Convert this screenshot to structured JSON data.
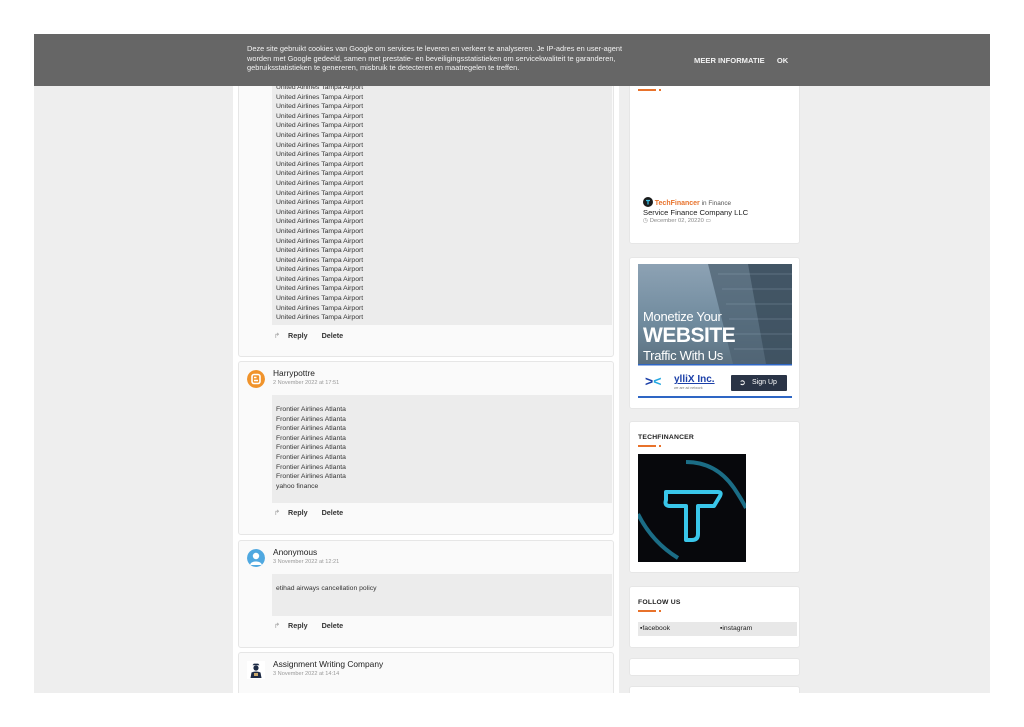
{
  "cookie_bar": {
    "line1": "Deze site gebruikt cookies van Google om services te leveren en verkeer te analyseren. Je IP-adres en user-agent",
    "line2": "worden met Google gedeeld, samen met prestatie- en beveiligingsstatistieken om servicekwaliteit te garanderen,",
    "line3": "gebruiksstatistieken te genereren, misbruik te detecteren en maatregelen te treffen.",
    "more_info": "MEER INFORMATIE",
    "ok": "OK"
  },
  "comments": [
    {
      "author": "",
      "date": "",
      "lines": [
        "United Airlines Tampa Airport",
        "United Airlines Tampa Airport",
        "United Airlines Tampa Airport",
        "United Airlines Tampa Airport",
        "United Airlines Tampa Airport",
        "United Airlines Tampa Airport",
        "United Airlines Tampa Airport",
        "United Airlines Tampa Airport",
        "United Airlines Tampa Airport",
        "United Airlines Tampa Airport",
        "United Airlines Tampa Airport",
        "United Airlines Tampa Airport",
        "United Airlines Tampa Airport",
        "United Airlines Tampa Airport",
        "United Airlines Tampa Airport",
        "United Airlines Tampa Airport",
        "United Airlines Tampa Airport",
        "United Airlines Tampa Airport",
        "United Airlines Tampa Airport",
        "United Airlines Tampa Airport",
        "United Airlines Tampa Airport",
        "United Airlines Tampa Airport",
        "United Airlines Tampa Airport",
        "United Airlines Tampa Airport",
        "United Airlines Tampa Airport"
      ],
      "reply": "Reply",
      "delete": "Delete"
    },
    {
      "author": "Harrypottre",
      "date": "2 November 2022 at 17:51",
      "lines": [
        "Frontier Airlines Atlanta",
        "Frontier Airlines Atlanta",
        "Frontier Airlines Atlanta",
        "Frontier Airlines Atlanta",
        "Frontier Airlines Atlanta",
        "Frontier Airlines Atlanta",
        "Frontier Airlines Atlanta",
        "Frontier Airlines Atlanta",
        "yahoo finance"
      ],
      "reply": "Reply",
      "delete": "Delete"
    },
    {
      "author": "Anonymous",
      "date": "3 November 2022 at 12:21",
      "lines": [
        "etihad airways cancellation policy"
      ],
      "reply": "Reply",
      "delete": "Delete"
    },
    {
      "author": "Assignment Writing Company",
      "date": "3 November 2022 at 14:14",
      "lines": [],
      "reply": "",
      "delete": ""
    }
  ],
  "sidebar": {
    "post": {
      "author": "TechFinancer",
      "in_word": "in",
      "category": "Finance",
      "title": "Service Finance Company LLC",
      "date": "December 02, 20220"
    },
    "ad": {
      "line1": "Monetize Your",
      "line2": "WEBSITE",
      "line3": "Traffic With Us",
      "brand": "ylliX Inc.",
      "brand_tagline": "we are ad network",
      "cta": "Sign Up"
    },
    "techfinancer_widget": {
      "title": "TECHFINANCER"
    },
    "follow_widget": {
      "title": "FOLLOW US",
      "links": [
        "facebook",
        "instagram"
      ]
    }
  },
  "colors": {
    "accent": "#e8722b",
    "cookie_bar": "#666666",
    "page_bg": "#eeeeee",
    "blogger_orange": "#f0932b",
    "anon_blue": "#4fa8e0"
  }
}
